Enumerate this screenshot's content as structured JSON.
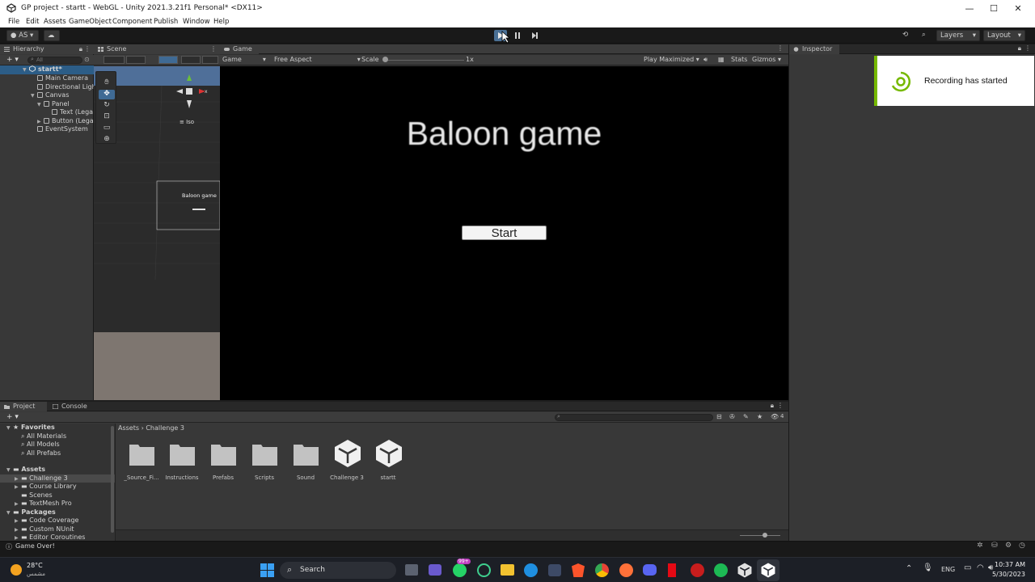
{
  "window": {
    "title": "GP project - startt - WebGL - Unity 2021.3.21f1 Personal* <DX11>",
    "controls": {
      "minimize": "—",
      "maximize": "☐",
      "close": "✕"
    }
  },
  "menu": [
    "File",
    "Edit",
    "Assets",
    "GameObject",
    "Component",
    "Publish",
    "Window",
    "Help"
  ],
  "toolbar": {
    "account": "AS",
    "layers": "Layers",
    "layout": "Layout"
  },
  "hierarchy": {
    "tab": "Hierarchy",
    "search_placeholder": "All",
    "items": [
      {
        "label": "startt*",
        "depth": 0,
        "expanded": true,
        "selected": true
      },
      {
        "label": "Main Camera",
        "depth": 1
      },
      {
        "label": "Directional Ligh",
        "depth": 1
      },
      {
        "label": "Canvas",
        "depth": 1,
        "expanded": true
      },
      {
        "label": "Panel",
        "depth": 2,
        "expanded": true
      },
      {
        "label": "Text (Lega",
        "depth": 3
      },
      {
        "label": "Button (Lega",
        "depth": 2,
        "collapsed": true
      },
      {
        "label": "EventSystem",
        "depth": 1
      }
    ]
  },
  "scene": {
    "tab": "Scene",
    "iso_label": "≡ Iso",
    "gizmo_x": "x",
    "canvas_text": "Baloon game"
  },
  "game": {
    "tab": "Game",
    "display": "Game",
    "aspect": "Free Aspect",
    "scale_label": "Scale",
    "scale_value": "1x",
    "play_mode": "Play Maximized",
    "stats": "Stats",
    "gizmos": "Gizmos",
    "title_text": "Baloon game",
    "start_button": "Start"
  },
  "inspector": {
    "tab": "Inspector",
    "notification": "Recording has started"
  },
  "project": {
    "tabs": [
      "Project",
      "Console"
    ],
    "breadcrumb": [
      "Assets",
      "Challenge 3"
    ],
    "badge": "4",
    "tree": [
      {
        "label": "Favorites",
        "type": "header"
      },
      {
        "label": "All Materials",
        "type": "search"
      },
      {
        "label": "All Models",
        "type": "search"
      },
      {
        "label": "All Prefabs",
        "type": "search"
      },
      {
        "label": "Assets",
        "type": "header"
      },
      {
        "label": "Challenge 3",
        "type": "folder",
        "selected": true
      },
      {
        "label": "Course Library",
        "type": "folder"
      },
      {
        "label": "Scenes",
        "type": "folder"
      },
      {
        "label": "TextMesh Pro",
        "type": "folder"
      },
      {
        "label": "Packages",
        "type": "header"
      },
      {
        "label": "Code Coverage",
        "type": "folder"
      },
      {
        "label": "Custom NUnit",
        "type": "folder"
      },
      {
        "label": "Editor Coroutines",
        "type": "folder"
      }
    ],
    "assets": [
      {
        "label": "_Source_Fi...",
        "kind": "folder"
      },
      {
        "label": "Instructions",
        "kind": "folder"
      },
      {
        "label": "Prefabs",
        "kind": "folder"
      },
      {
        "label": "Scripts",
        "kind": "folder"
      },
      {
        "label": "Sound",
        "kind": "folder"
      },
      {
        "label": "Challenge 3",
        "kind": "unity"
      },
      {
        "label": "startt",
        "kind": "unity"
      }
    ]
  },
  "status": {
    "message": "Game Over!"
  },
  "taskbar": {
    "weather_temp": "28°C",
    "weather_desc": "مشمس",
    "search": "Search",
    "whatsapp_badge": "99+",
    "lang": "ENG",
    "time": "10:37 AM",
    "date": "5/30/2023"
  },
  "colors": {
    "selection": "#2c5d87",
    "recording_accent": "#76b900",
    "panel": "#383838",
    "game_bg": "#000000"
  }
}
